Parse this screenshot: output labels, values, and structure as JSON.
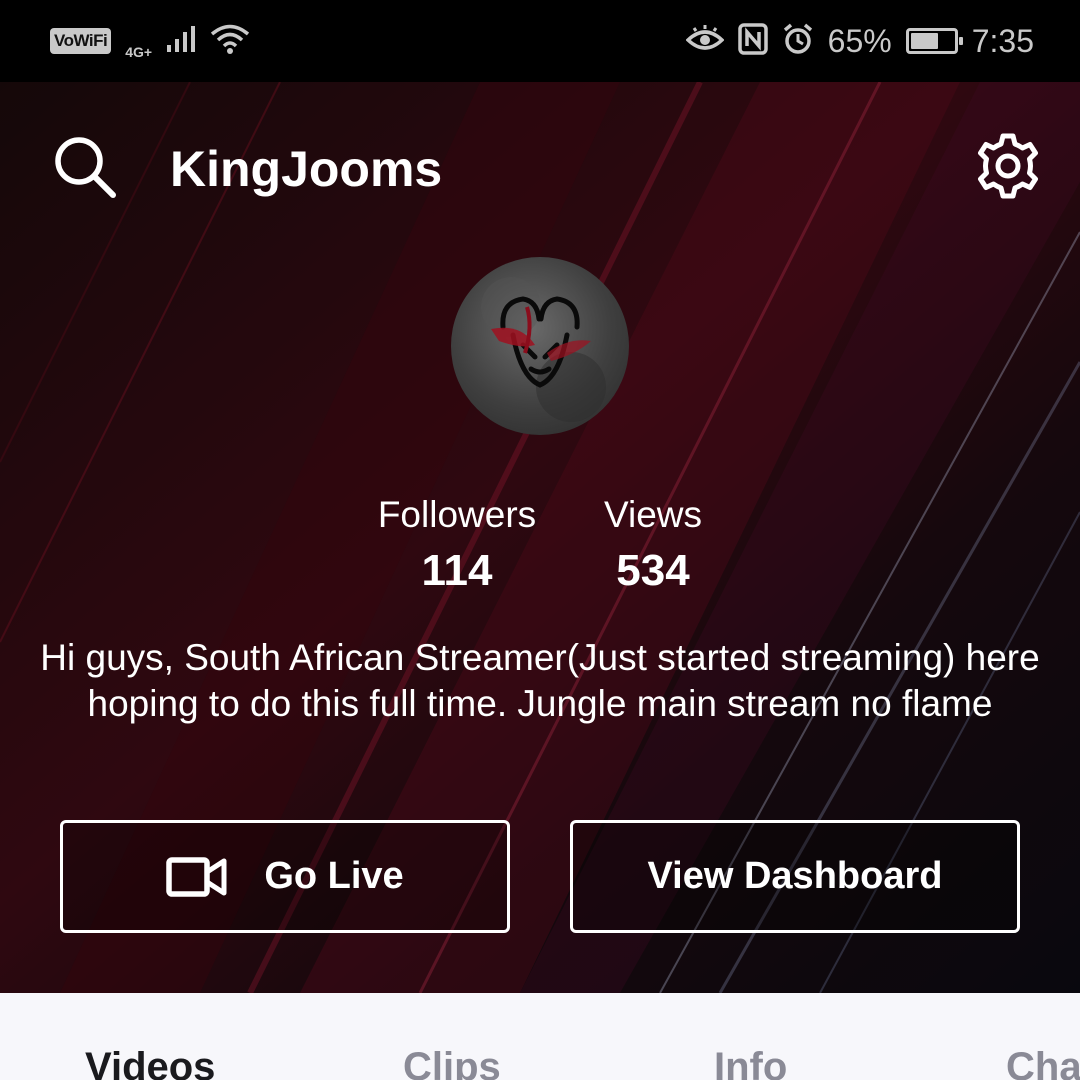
{
  "status_bar": {
    "wifi_badge": "VoWiFi",
    "network": "4G+",
    "battery_text": "65%",
    "battery_level": 0.65,
    "time": "7:35",
    "icons": [
      "signal-icon",
      "wifi-icon",
      "eye-icon",
      "nfc-icon",
      "alarm-icon",
      "battery-icon"
    ]
  },
  "header": {
    "profile_name": "KingJooms",
    "icons": [
      "search-icon",
      "gear-icon"
    ]
  },
  "profile": {
    "followers_label": "Followers",
    "followers_value": "114",
    "views_label": "Views",
    "views_value": "534",
    "bio": "Hi guys, South African Streamer(Just started streaming) here hoping to do this full time. Jungle main stream no flame"
  },
  "actions": {
    "go_live_label": "Go Live",
    "view_dashboard_label": "View Dashboard"
  },
  "tabs": [
    {
      "label": "Videos",
      "active": true
    },
    {
      "label": "Clips",
      "active": false
    },
    {
      "label": "Info",
      "active": false
    },
    {
      "label": "Chat",
      "active": false
    }
  ],
  "colors": {
    "background": "#0b0507",
    "accent_red": "#8a1428",
    "tab_bar": "#f7f7fb",
    "tab_active": "#1a1a1e",
    "tab_inactive": "#8a8a96"
  }
}
